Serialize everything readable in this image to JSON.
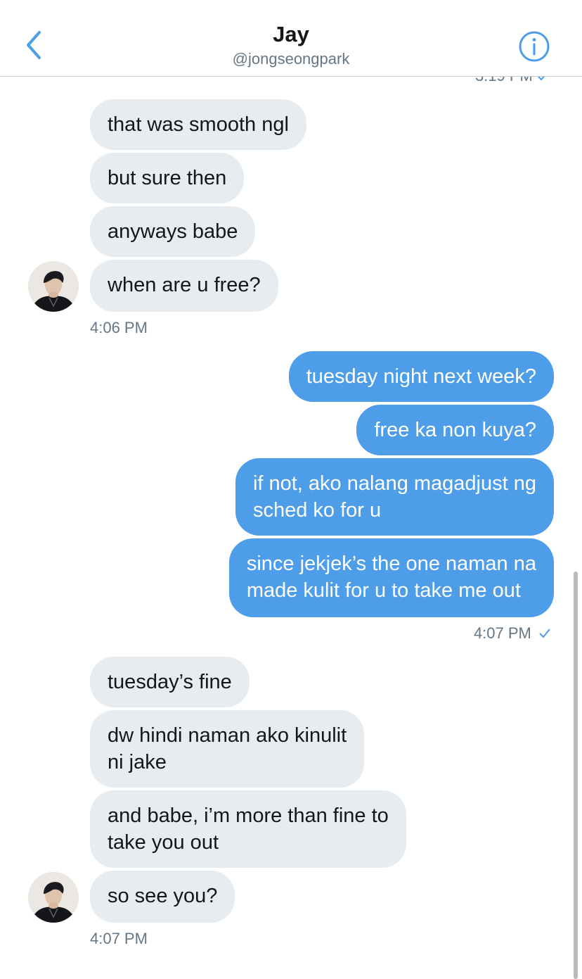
{
  "header": {
    "title": "Jay",
    "handle": "@jongseongpark",
    "back_icon": "chevron-left-icon",
    "info_icon": "info-circle-icon",
    "accent_color": "#4d9de8"
  },
  "clipped_timestamp": "3:19 PM",
  "groups": [
    {
      "sender": "contact",
      "messages": [
        "that was smooth ngl",
        "but sure then",
        "anyways babe",
        "when are u free?"
      ],
      "timestamp": "4:06 PM"
    },
    {
      "sender": "me",
      "messages": [
        "tuesday night next week?",
        "free ka non kuya?",
        "if not, ako nalang magadjust ng\nsched ko for u",
        "since jekjek’s the one naman na\nmade kulit for u to take me out"
      ],
      "timestamp": "4:07 PM",
      "status_icon": "checkmark-icon"
    },
    {
      "sender": "contact",
      "messages": [
        "tuesday’s fine",
        "dw hindi naman ako kinulit\nni jake",
        "and babe, i’m more than fine to\ntake you out",
        "so see you?"
      ],
      "timestamp": "4:07 PM"
    }
  ],
  "colors": {
    "incoming_bubble": "#e6ecf0",
    "outgoing_bubble": "#4d9de8",
    "meta_text": "#657786"
  }
}
